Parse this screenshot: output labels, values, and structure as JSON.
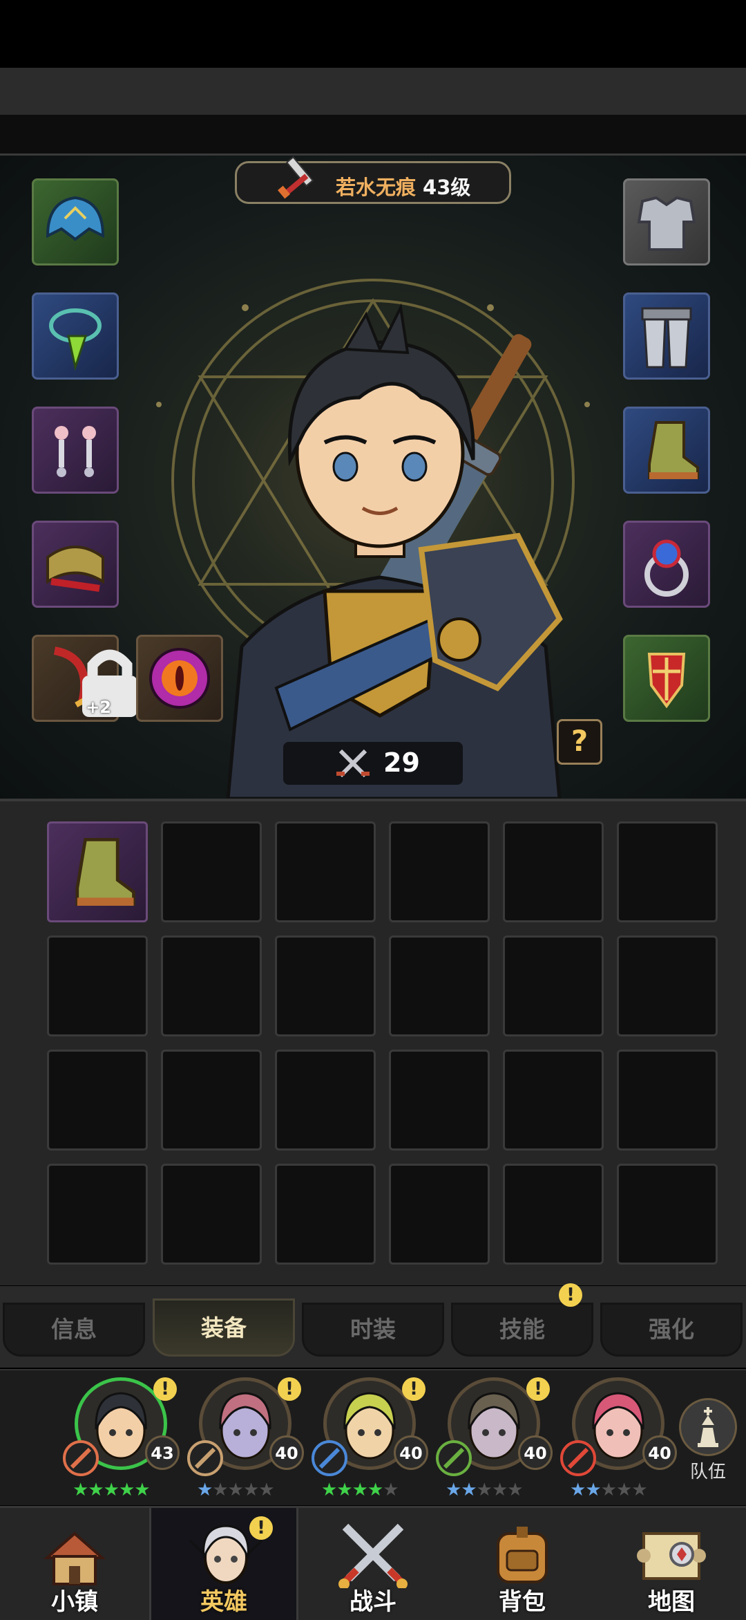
{
  "hero_panel": {
    "hero_name": "若水无痕",
    "hero_level": "43级",
    "combat_power": "29",
    "help_label": "?",
    "weapon_enhance": "+2",
    "slots_left": [
      {
        "name": "helmet",
        "rarity": "green"
      },
      {
        "name": "necklace",
        "rarity": "blue"
      },
      {
        "name": "earrings",
        "rarity": "purple"
      },
      {
        "name": "bracer",
        "rarity": "purple"
      },
      {
        "name": "scimitar",
        "rarity": "brown"
      },
      {
        "name": "eye-orb",
        "rarity": "brown"
      }
    ],
    "slots_right": [
      {
        "name": "chest-armor",
        "rarity": "gray"
      },
      {
        "name": "leg-armor",
        "rarity": "blue"
      },
      {
        "name": "boots",
        "rarity": "blue"
      },
      {
        "name": "ring",
        "rarity": "purple"
      },
      {
        "name": "shield",
        "rarity": "green"
      }
    ]
  },
  "inventory": {
    "items": [
      {
        "name": "boots",
        "rarity": "purple"
      }
    ],
    "total_slots": 24
  },
  "tabs": [
    {
      "label": "信息",
      "active": false,
      "alert": false
    },
    {
      "label": "装备",
      "active": true,
      "alert": false
    },
    {
      "label": "时装",
      "active": false,
      "alert": false
    },
    {
      "label": "技能",
      "active": false,
      "alert": true
    },
    {
      "label": "强化",
      "active": false,
      "alert": false
    }
  ],
  "alert_symbol": "!",
  "heroes": [
    {
      "level": "43",
      "stars": 5,
      "max_stars": 5,
      "star_color": "green",
      "selected": true,
      "alert": true
    },
    {
      "level": "40",
      "stars": 1,
      "max_stars": 5,
      "star_color": "blue",
      "selected": false,
      "alert": true
    },
    {
      "level": "40",
      "stars": 4,
      "max_stars": 5,
      "star_color": "green",
      "selected": false,
      "alert": true
    },
    {
      "level": "40",
      "stars": 2,
      "max_stars": 5,
      "star_color": "blue",
      "selected": false,
      "alert": true
    },
    {
      "level": "40",
      "stars": 2,
      "max_stars": 5,
      "star_color": "blue",
      "selected": false,
      "alert": false
    }
  ],
  "team_label": "队伍",
  "bottom_nav": [
    {
      "label": "小镇",
      "icon": "town-icon",
      "active": false
    },
    {
      "label": "英雄",
      "icon": "hero-icon",
      "active": true,
      "alert": true
    },
    {
      "label": "战斗",
      "icon": "crossed-swords-icon",
      "active": false
    },
    {
      "label": "背包",
      "icon": "backpack-icon",
      "active": false
    },
    {
      "label": "地图",
      "icon": "map-scroll-icon",
      "active": false
    }
  ],
  "colors": {
    "hero_name": "#f0b060",
    "active_tab_text": "#f3e7c0",
    "alert": "#f3d150",
    "selected_hero_ring": "#3bc44a"
  }
}
